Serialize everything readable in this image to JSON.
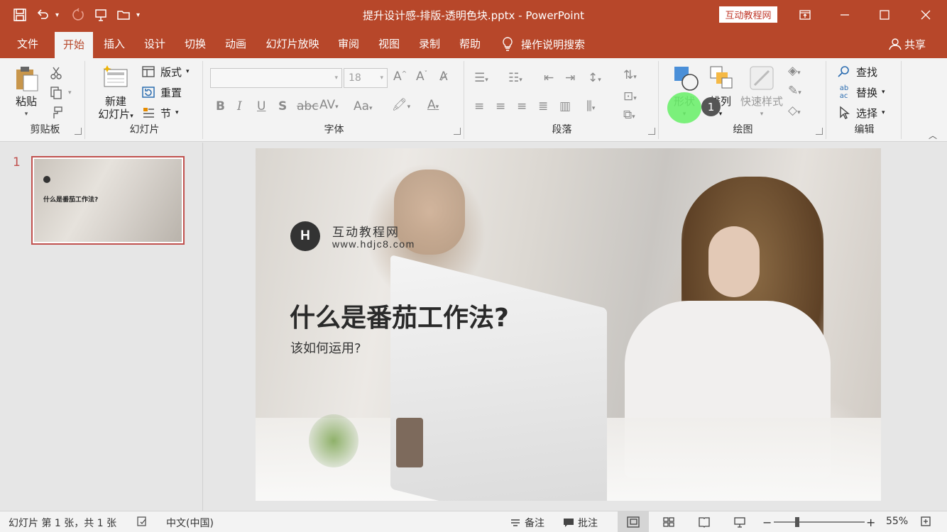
{
  "titlebar": {
    "doc_title": "提升设计感-排版-透明色块.pptx  -  PowerPoint",
    "brand_badge": "互动教程网"
  },
  "tabs": {
    "items": [
      "文件",
      "开始",
      "插入",
      "设计",
      "切换",
      "动画",
      "幻灯片放映",
      "审阅",
      "视图",
      "录制",
      "帮助"
    ],
    "active": "开始",
    "search_label": "操作说明搜索",
    "share_label": "共享"
  },
  "ribbon": {
    "clipboard": {
      "label": "剪贴板",
      "paste": "粘贴"
    },
    "slides": {
      "label": "幻灯片",
      "new_slide_1": "新建",
      "new_slide_2": "幻灯片",
      "layout": "版式",
      "reset": "重置",
      "section": "节"
    },
    "font": {
      "label": "字体",
      "font_size": "18"
    },
    "paragraph": {
      "label": "段落"
    },
    "drawing": {
      "label": "绘图",
      "shapes": "形状",
      "arrange": "排列",
      "quick_styles": "快速样式"
    },
    "editing": {
      "label": "编辑",
      "find": "查找",
      "replace": "替换",
      "select": "选择"
    }
  },
  "step_badge": "1",
  "slides_panel": {
    "slide_number": "1",
    "thumb_title": "什么是番茄工作法?"
  },
  "slide": {
    "logo_letter": "H",
    "brand": "互动教程网",
    "url": "www.hdjc8.com",
    "title": "什么是番茄工作法?",
    "subtitle": "该如何运用?"
  },
  "statusbar": {
    "slide_info": "幻灯片 第 1 张，共 1 张",
    "language": "中文(中国)",
    "notes": "备注",
    "comments": "批注",
    "zoom": "55%"
  }
}
